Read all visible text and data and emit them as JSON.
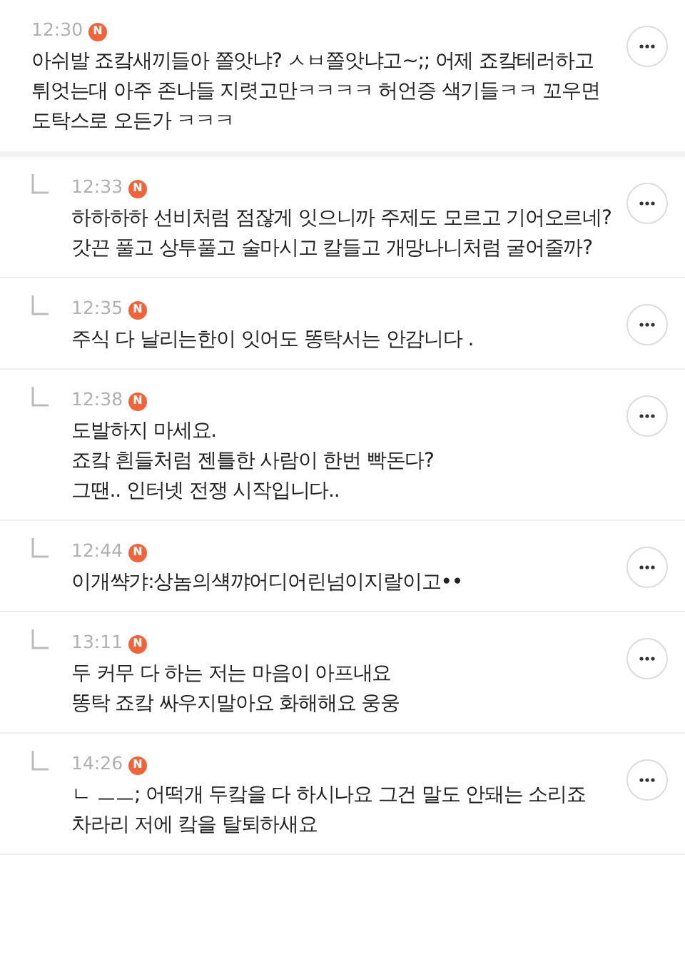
{
  "comments": [
    {
      "kind": "comment",
      "time": "12:30",
      "badge": "N",
      "body": "아쉬발 죠캌새끼들아 쫄앗냐? ㅅㅂ쫄앗냐고~;; 어제 죠캌테러하고 튀엇는대 아주 존나들 지렷고만ㅋㅋㅋㅋ 허언증 색기들ㅋㅋ 꼬우면 도탁스로 오든가 ㅋㅋㅋ"
    },
    {
      "kind": "reply",
      "time": "12:33",
      "badge": "N",
      "body": "하하하하 선비처럼 점잖게 잇으니까 주제도 모르고 기어오르네?\n갓끈 풀고 상투풀고 술마시고 칼들고 개망나니처럼 굴어줄까?"
    },
    {
      "kind": "reply",
      "time": "12:35",
      "badge": "N",
      "body": "주식 다 날리는한이 잇어도 똥탁서는 안감니다 ."
    },
    {
      "kind": "reply",
      "time": "12:38",
      "badge": "N",
      "body": "도발하지 마세요.\n죠캌 흰들처럼 젠틀한 사람이 한번 빡돈다?\n그땐.. 인터넷 전쟁 시작입니다.."
    },
    {
      "kind": "reply",
      "time": "12:44",
      "badge": "N",
      "body": "이개쌱갸:상놈의섁꺄어디어린넘이지랄이고••"
    },
    {
      "kind": "reply",
      "time": "13:11",
      "badge": "N",
      "body": "두 커무 다 하는 저는 마음이 아프내요\n똥탁 죠캌 싸우지말아요 화해해요 웅웅"
    },
    {
      "kind": "reply",
      "time": "14:26",
      "badge": "N",
      "body": "ㄴ ㅡㅡ; 어떡개 두캌을 다 하시나요 그건 말도 안돼는 소리죠\n차라리 저에 캌을 탈퇴하새요"
    }
  ]
}
